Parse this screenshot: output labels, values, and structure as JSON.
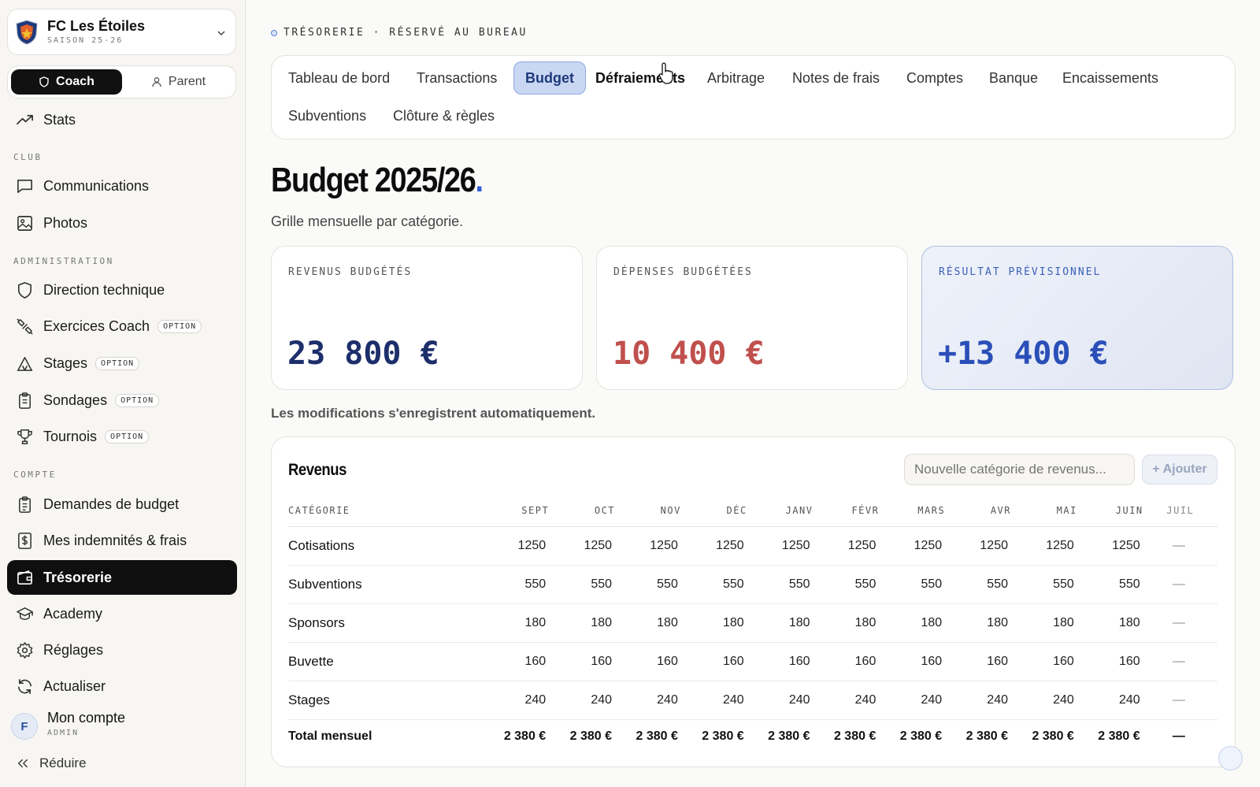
{
  "sidebar": {
    "club": {
      "name": "FC Les Étoiles",
      "season": "SAISON 25-26"
    },
    "roles": {
      "coach": "Coach",
      "parent": "Parent"
    },
    "top_item": {
      "label": "Stats",
      "icon": "trending-up-icon"
    },
    "sections": {
      "club": "CLUB",
      "administration": "ADMINISTRATION",
      "compte": "COMPTE"
    },
    "club_items": [
      {
        "label": "Communications",
        "icon": "message-icon"
      },
      {
        "label": "Photos",
        "icon": "image-icon"
      }
    ],
    "admin_items": [
      {
        "label": "Direction technique",
        "icon": "shield-icon"
      },
      {
        "label": "Exercices Coach",
        "icon": "dumbbell-icon",
        "badge": "OPTION"
      },
      {
        "label": "Stages",
        "icon": "tent-icon",
        "badge": "OPTION"
      },
      {
        "label": "Sondages",
        "icon": "clipboard-icon",
        "badge": "OPTION"
      },
      {
        "label": "Tournois",
        "icon": "trophy-icon",
        "badge": "OPTION"
      }
    ],
    "compte_items": [
      {
        "label": "Demandes de budget",
        "icon": "clipboard-list-icon"
      },
      {
        "label": "Mes indemnités & frais",
        "icon": "receipt-dollar-icon"
      },
      {
        "label": "Trésorerie",
        "icon": "wallet-icon",
        "active": true
      },
      {
        "label": "Academy",
        "icon": "graduation-cap-icon"
      },
      {
        "label": "Réglages",
        "icon": "gear-icon"
      },
      {
        "label": "Actualiser",
        "icon": "refresh-icon"
      }
    ],
    "account": {
      "initial": "F",
      "name": "Mon compte",
      "role": "ADMIN"
    },
    "collapse": "Réduire"
  },
  "main": {
    "eyebrow": "TRÉSORERIE · RÉSERVÉ AU BUREAU",
    "tabs": [
      "Tableau de bord",
      "Transactions",
      "Budget",
      "Défraiements",
      "Arbitrage",
      "Notes de frais",
      "Comptes",
      "Banque",
      "Encaissements",
      "Subventions",
      "Clôture & règles"
    ],
    "active_tab": "Budget",
    "title": "Budget 2025/26",
    "title_dot": ".",
    "subtitle": "Grille mensuelle par catégorie.",
    "kpis": [
      {
        "label": "REVENUS BUDGÉTÉS",
        "value": "23 800 €",
        "color": "#1d2f6b"
      },
      {
        "label": "DÉPENSES BUDGÉTÉES",
        "value": "10 400 €",
        "color": "#c0504d"
      },
      {
        "label": "RÉSULTAT PRÉVISIONNEL",
        "value": "+13 400 €",
        "color": "#2b4fb8"
      }
    ],
    "autosave_note": "Les modifications s'enregistrent automatiquement.",
    "revenus": {
      "title": "Revenus",
      "new_category_placeholder": "Nouvelle catégorie de revenus...",
      "add_label": "+ Ajouter",
      "columns": [
        "CATÉGORIE",
        "SEPT",
        "OCT",
        "NOV",
        "DÉC",
        "JANV",
        "FÉVR",
        "MARS",
        "AVR",
        "MAI",
        "JUIN",
        "JUIL"
      ],
      "rows": [
        {
          "category": "Cotisations",
          "values": [
            "1250",
            "1250",
            "1250",
            "1250",
            "1250",
            "1250",
            "1250",
            "1250",
            "1250",
            "1250",
            "—"
          ]
        },
        {
          "category": "Subventions",
          "values": [
            "550",
            "550",
            "550",
            "550",
            "550",
            "550",
            "550",
            "550",
            "550",
            "550",
            "—"
          ]
        },
        {
          "category": "Sponsors",
          "values": [
            "180",
            "180",
            "180",
            "180",
            "180",
            "180",
            "180",
            "180",
            "180",
            "180",
            "—"
          ]
        },
        {
          "category": "Buvette",
          "values": [
            "160",
            "160",
            "160",
            "160",
            "160",
            "160",
            "160",
            "160",
            "160",
            "160",
            "—"
          ]
        },
        {
          "category": "Stages",
          "values": [
            "240",
            "240",
            "240",
            "240",
            "240",
            "240",
            "240",
            "240",
            "240",
            "240",
            "—"
          ]
        }
      ],
      "total": {
        "label": "Total mensuel",
        "values": [
          "2 380 €",
          "2 380 €",
          "2 380 €",
          "2 380 €",
          "2 380 €",
          "2 380 €",
          "2 380 €",
          "2 380 €",
          "2 380 €",
          "2 380 €",
          "—"
        ]
      }
    }
  }
}
